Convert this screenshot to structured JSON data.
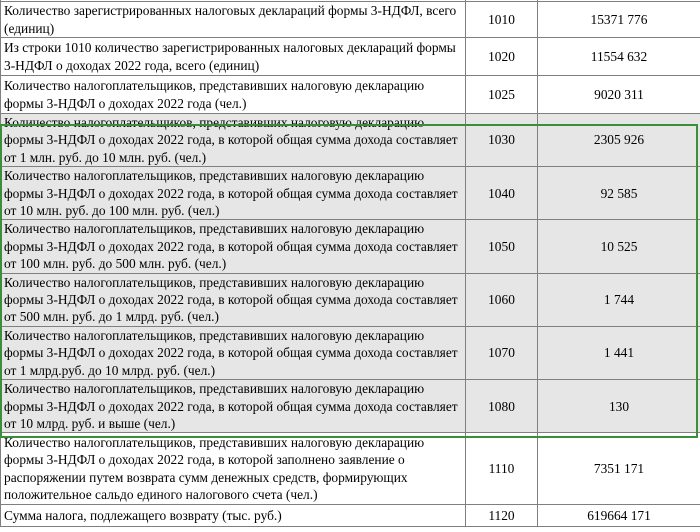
{
  "rows": [
    {
      "desc": "Количество зарегистрированных налоговых деклараций формы 3-НДФЛ, всего (единиц)",
      "code": "1010",
      "value": "15371 776",
      "shaded": false
    },
    {
      "desc": "Из строки 1010 количество зарегистрированных налоговых деклараций формы 3-НДФЛ о доходах 2022 года, всего (единиц)",
      "code": "1020",
      "value": "11554 632",
      "shaded": false
    },
    {
      "desc": "Количество налогоплательщиков, представивших налоговую декларацию формы 3-НДФЛ о доходах 2022 года (чел.)",
      "code": "1025",
      "value": "9020 311",
      "shaded": false
    },
    {
      "desc": "Количество налогоплательщиков, представивших налоговую декларацию формы 3-НДФЛ о доходах 2022 года, в которой общая сумма дохода составляет  от 1 млн. руб. до 10 млн. руб. (чел.)",
      "code": "1030",
      "value": "2305 926",
      "shaded": true
    },
    {
      "desc": "Количество налогоплательщиков, представивших налоговую декларацию формы 3-НДФЛ о доходах 2022 года, в которой общая сумма дохода составляет  от 10 млн. руб. до 100 млн. руб. (чел.)",
      "code": "1040",
      "value": "92 585",
      "shaded": true
    },
    {
      "desc": "Количество налогоплательщиков, представивших налоговую декларацию формы 3-НДФЛ о доходах 2022 года, в которой общая сумма дохода составляет  от 100 млн. руб. до 500 млн. руб. (чел.)",
      "code": "1050",
      "value": "10 525",
      "shaded": true
    },
    {
      "desc": "Количество налогоплательщиков, представивших налоговую декларацию формы 3-НДФЛ о доходах 2022 года, в которой общая сумма дохода составляет  от 500 млн. руб. до 1 млрд. руб. (чел.)",
      "code": "1060",
      "value": "1 744",
      "shaded": true
    },
    {
      "desc": "Количество налогоплательщиков, представивших налоговую декларацию формы 3-НДФЛ о доходах 2022 года, в которой общая сумма дохода составляет  от 1 млрд.руб. до 10 млрд. руб. (чел.)",
      "code": "1070",
      "value": "1 441",
      "shaded": true
    },
    {
      "desc": "Количество налогоплательщиков, представивших налоговую декларацию формы 3-НДФЛ о доходах 2022 года, в которой общая сумма дохода составляет  от 10 млрд. руб. и выше (чел.)",
      "code": "1080",
      "value": "130",
      "shaded": true
    },
    {
      "desc": "Количество налогоплательщиков, представивших налоговую декларацию формы 3-НДФЛ о доходах 2022 года, в которой заполнено заявление о распоряжении путем возврата сумм денежных средств, формирующих положительное сальдо единого налогового счета (чел.)",
      "code": "1110",
      "value": "7351 171",
      "shaded": false
    },
    {
      "desc": "Сумма налога, подлежащего возврату (тыс. руб.)",
      "code": "1120",
      "value": "619664 171",
      "shaded": false
    }
  ],
  "colors": {
    "border": "#7f7f7f",
    "shade": "#e6e6e6",
    "selection": "#3a8f3a"
  }
}
